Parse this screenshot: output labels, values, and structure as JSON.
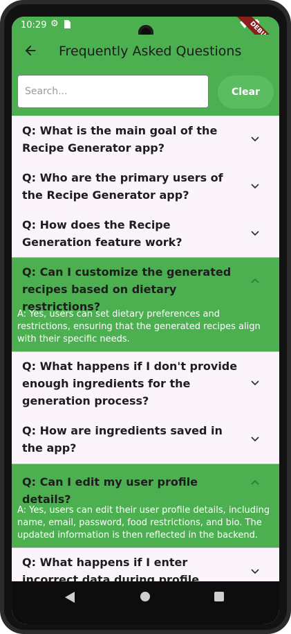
{
  "status_bar": {
    "time": "10:29",
    "icons": [
      "settings-icon",
      "sim-card-icon",
      "wifi-icon",
      "battery-icon"
    ],
    "debug_label": "DEBUG"
  },
  "app_bar": {
    "title": "Frequently Asked Questions",
    "back_icon": "arrow-back-icon"
  },
  "search": {
    "placeholder": "Search...",
    "value": "",
    "clear_label": "Clear"
  },
  "faq": [
    {
      "question": "Q: What is the main goal of the Recipe Generator app?",
      "expanded": false,
      "answer": ""
    },
    {
      "question": "Q: Who are the primary users of the Recipe Generator app?",
      "expanded": false,
      "answer": ""
    },
    {
      "question": "Q: How does the Recipe Generation feature work?",
      "expanded": false,
      "answer": ""
    },
    {
      "question": "Q: Can I customize the generated recipes based on dietary restrictions?",
      "expanded": true,
      "answer": "A: Yes, users can set dietary preferences and restrictions, ensuring that the generated recipes align with their specific needs."
    },
    {
      "question": "Q: What happens if I don't provide enough ingredients for the generation process?",
      "expanded": false,
      "answer": ""
    },
    {
      "question": "Q: How are ingredients saved in the app?",
      "expanded": false,
      "answer": ""
    },
    {
      "question": "Q: Can I edit my user profile details?",
      "expanded": true,
      "answer": "A: Yes, users can edit their user profile details, including name, email, password, food restrictions, and bio. The updated information is then reflected in the backend."
    },
    {
      "question": "Q: What happens if I enter incorrect data during profile editing?",
      "expanded": false,
      "answer": ""
    }
  ],
  "colors": {
    "primary": "#4caf50",
    "background": "#fbf4fb",
    "answer_text": "#ffffff"
  },
  "nav_bar": {
    "icons": [
      "nav-back-icon",
      "nav-home-icon",
      "nav-recents-icon"
    ]
  }
}
